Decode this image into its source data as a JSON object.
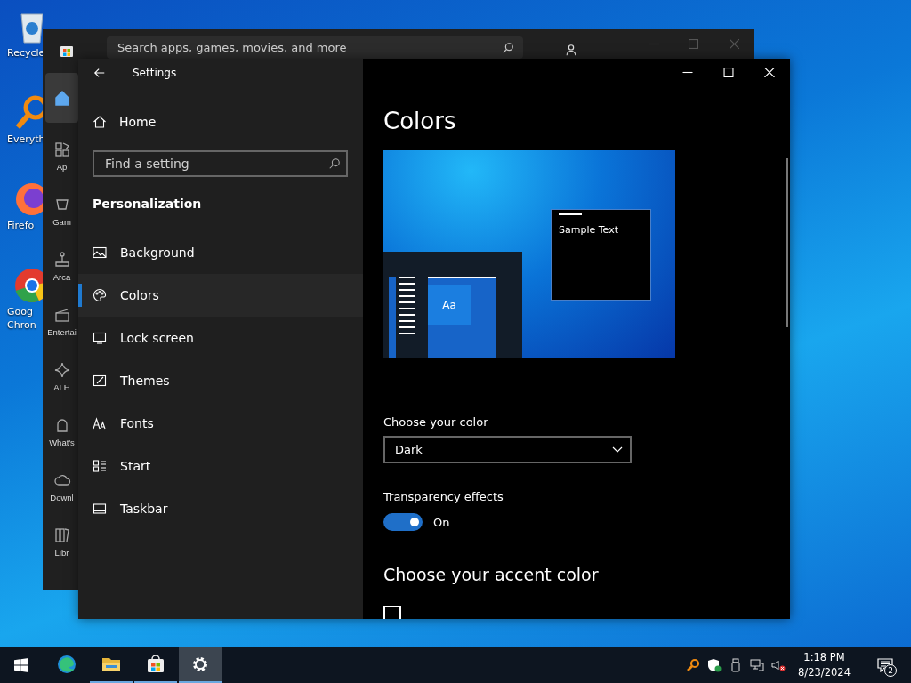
{
  "desktop": {
    "icons": [
      {
        "kind": "recycle",
        "labels": [
          "Recycle"
        ]
      },
      {
        "kind": "everything",
        "labels": [
          "Everyth"
        ]
      },
      {
        "kind": "firefox",
        "labels": [
          "Firefo"
        ]
      },
      {
        "kind": "chrome",
        "labels": [
          "Goog",
          "Chron"
        ]
      }
    ]
  },
  "store_window": {
    "search": {
      "placeholder": "Search apps, games, movies, and more"
    },
    "nav": [
      {
        "kind": "home",
        "selected": true
      },
      {
        "kind": "apps",
        "label": "Ap",
        "selected": false
      },
      {
        "kind": "gaming",
        "label": "Gam",
        "selected": false
      },
      {
        "kind": "arcade",
        "label": "Arca",
        "selected": false
      },
      {
        "kind": "entertainment",
        "label": "Entertai",
        "selected": false
      },
      {
        "kind": "ai",
        "label": "AI H",
        "selected": false
      },
      {
        "kind": "whatsnew",
        "label": "What's",
        "selected": false
      },
      {
        "kind": "downloads",
        "label": "Downl",
        "selected": false
      },
      {
        "kind": "library",
        "label": "Libr",
        "selected": false
      }
    ]
  },
  "settings": {
    "title": "Settings",
    "sidebar": {
      "home": "Home",
      "search": {
        "placeholder": "Find a setting"
      },
      "section": "Personalization",
      "items": [
        {
          "kind": "image",
          "label": "Background",
          "selected": false
        },
        {
          "kind": "palette",
          "label": "Colors",
          "selected": true
        },
        {
          "kind": "lock",
          "label": "Lock screen",
          "selected": false
        },
        {
          "kind": "brush",
          "label": "Themes",
          "selected": false
        },
        {
          "kind": "font",
          "label": "Fonts",
          "selected": false
        },
        {
          "kind": "start",
          "label": "Start",
          "selected": false
        },
        {
          "kind": "taskbar",
          "label": "Taskbar",
          "selected": false
        }
      ]
    },
    "page": {
      "title": "Colors",
      "preview": {
        "tile_text": "Aa",
        "window_text": "Sample Text"
      },
      "color_mode": {
        "label": "Choose your color",
        "value": "Dark"
      },
      "transparency": {
        "label": "Transparency effects",
        "on": true,
        "state_text": "On"
      },
      "accent_heading": "Choose your accent color",
      "auto_accent": {
        "checked": false
      }
    }
  },
  "taskbar": {
    "apps": [
      {
        "kind": "edge",
        "running": false,
        "active": false
      },
      {
        "kind": "explorer",
        "running": true,
        "active": false
      },
      {
        "kind": "store",
        "running": true,
        "active": false
      },
      {
        "kind": "settings",
        "running": true,
        "active": true
      }
    ],
    "tray": {
      "time": "1:18 PM",
      "date": "8/23/2024",
      "notifications": "2"
    }
  }
}
